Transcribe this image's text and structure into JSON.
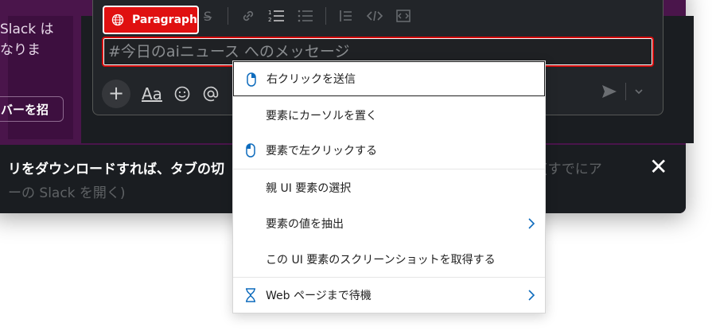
{
  "sidebar": {
    "line1": "Slack は",
    "line2": "なりま",
    "invite_button": "バーを招"
  },
  "composer": {
    "paragraph_chip": "Paragraph",
    "message_placeholder": "#今日のaiニュース へのメッセージ",
    "aa_label": "Aa"
  },
  "banner": {
    "text_main": "リをダウンロードすれば、タブの切",
    "text_grey": "(すでにア",
    "text_link": "ーの Slack を開く)"
  },
  "context_menu": {
    "items": [
      {
        "label": "右クリックを送信",
        "icon": "mouse-right-click-icon"
      },
      {
        "label": "要素にカーソルを置く",
        "icon": ""
      },
      {
        "label": "要素で左クリックする",
        "icon": "mouse-left-click-icon"
      },
      {
        "label": "親 UI 要素の選択",
        "icon": ""
      },
      {
        "label": "要素の値を抽出",
        "icon": ""
      },
      {
        "label": "この UI 要素のスクリーンショットを取得する",
        "icon": ""
      },
      {
        "label": "Web ページまで待機",
        "icon": "hourglass-icon"
      }
    ]
  },
  "colors": {
    "accent_blue": "#0f6cbd",
    "chip_red": "#e01010",
    "slack_purple": "#4a154b"
  }
}
